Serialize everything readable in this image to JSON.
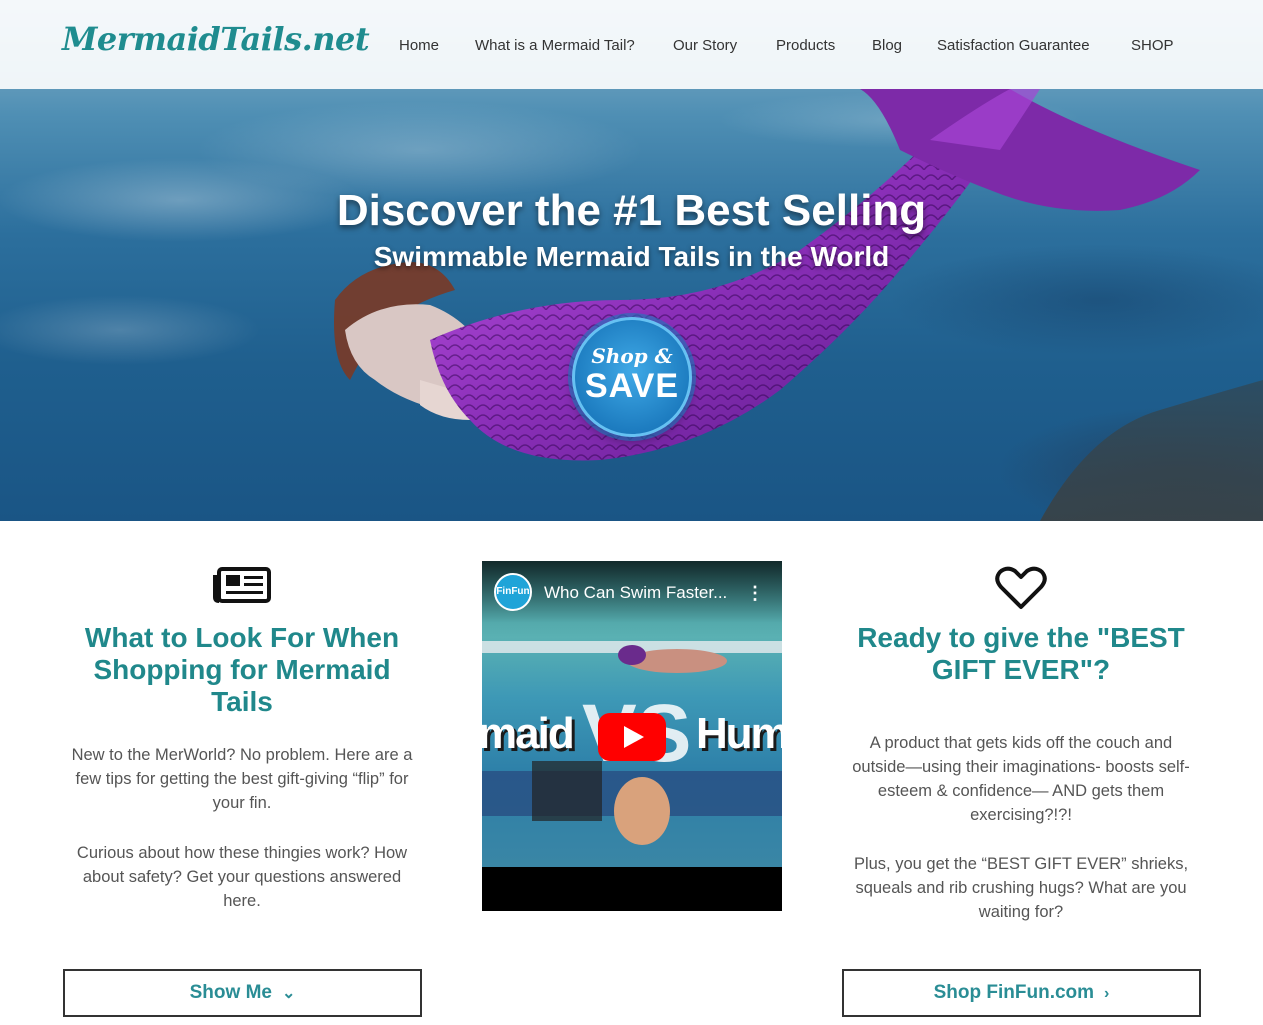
{
  "brand": {
    "logo_text": "MermaidTails.net"
  },
  "nav": {
    "items": [
      {
        "label": "Home"
      },
      {
        "label": "What is a Mermaid Tail?"
      },
      {
        "label": "Our Story"
      },
      {
        "label": "Products"
      },
      {
        "label": "Blog"
      },
      {
        "label": "Satisfaction Guarantee"
      },
      {
        "label": "SHOP"
      }
    ]
  },
  "hero": {
    "title": "Discover the #1 Best Selling",
    "subtitle": "Swimmable Mermaid Tails in the World",
    "badge_line1": "Shop &",
    "badge_line2": "SAVE"
  },
  "left_column": {
    "icon": "newspaper-icon",
    "heading": "What to Look For When Shopping for Mermaid Tails",
    "paragraph1": "New to the MerWorld? No problem. Here are a few tips for getting the best gift-giving “flip” for your fin.",
    "paragraph2": "Curious about how these thingies work? How about safety? Get your questions answered here.",
    "button_label": "Show Me",
    "button_icon": "chevron-down-icon"
  },
  "video": {
    "channel_icon_text": "FinFun",
    "title": "Who Can Swim Faster...",
    "menu_icon": "more-vert-icon",
    "thumb_word_left": "maid",
    "thumb_word_center": "VS",
    "thumb_word_right": "Hum",
    "play_icon": "play-icon"
  },
  "right_column": {
    "icon": "heart-icon",
    "heading": "Ready to give the \"BEST GIFT EVER\"?",
    "paragraph1": "A product that gets kids off the couch and outside—using their imaginations- boosts self-esteem & confidence— AND gets them exercising?!?!",
    "paragraph2": "Plus, you get the “BEST GIFT EVER” shrieks, squeals and rib crushing hugs? What are you waiting for?",
    "button_label": "Shop FinFun.com",
    "button_icon": "chevron-right-icon"
  },
  "colors": {
    "accent": "#20888b",
    "hero_water": "#2c6f9d",
    "tail_purple": "#8a2fb8",
    "badge_blue": "#1d7cc0"
  }
}
